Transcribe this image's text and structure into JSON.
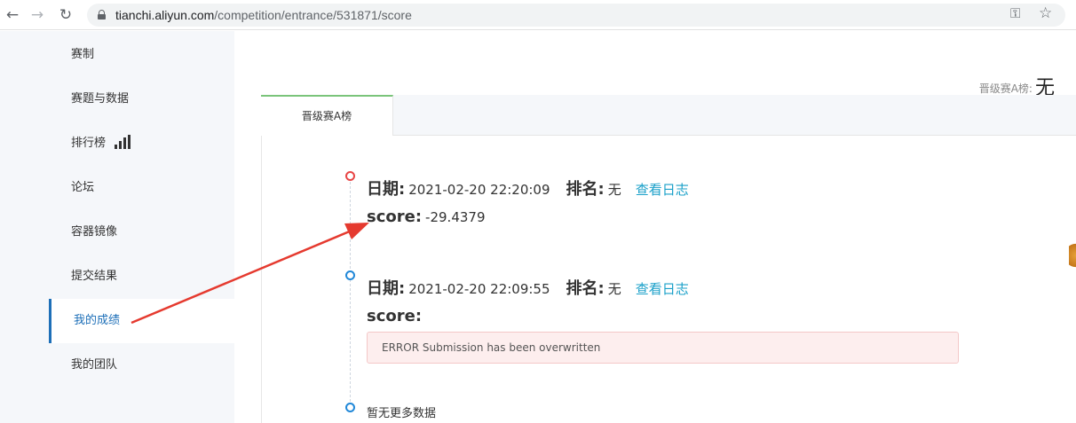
{
  "browser": {
    "url_host": "tianchi.aliyun.com",
    "url_path": "/competition/entrance/531871/score"
  },
  "sidebar": {
    "items": [
      {
        "label": "赛制"
      },
      {
        "label": "赛题与数据"
      },
      {
        "label": "排行榜"
      },
      {
        "label": "论坛"
      },
      {
        "label": "容器镜像"
      },
      {
        "label": "提交结果"
      },
      {
        "label": "我的成绩",
        "active": true
      },
      {
        "label": "我的团队"
      }
    ]
  },
  "leaderboard": {
    "label": "晋级赛A榜:",
    "value": "无"
  },
  "tabs": [
    {
      "label": "晋级赛A榜",
      "active": true
    }
  ],
  "entries": [
    {
      "date_label": "日期:",
      "date": "2021-02-20 22:20:09",
      "rank_label": "排名:",
      "rank": "无",
      "log_link": "查看日志",
      "score_label": "score:",
      "score": "-29.4379",
      "status_color": "#e84545"
    },
    {
      "date_label": "日期:",
      "date": "2021-02-20 22:09:55",
      "rank_label": "排名:",
      "rank": "无",
      "log_link": "查看日志",
      "score_label": "score:",
      "score": "",
      "error": "ERROR Submission has been overwritten",
      "status_color": "#2188d8"
    }
  ],
  "no_more": "暂无更多数据",
  "colors": {
    "accent": "#1d6fb8",
    "link": "#1aa0c9",
    "annotation_arrow": "#e53a2f"
  }
}
